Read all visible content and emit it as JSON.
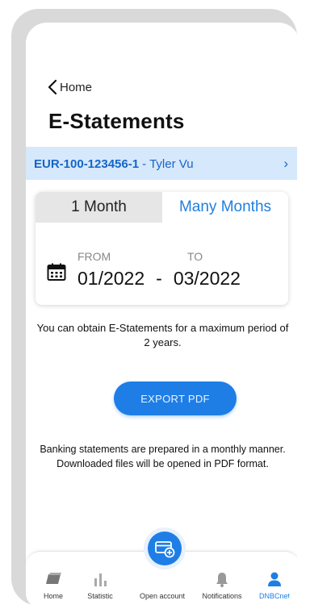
{
  "header": {
    "back_label": "Home",
    "title": "E-Statements"
  },
  "account": {
    "id": "EUR-100-123456-1",
    "separator": "-",
    "name": "Tyler Vu",
    "arrow": "›"
  },
  "period": {
    "tabs": [
      {
        "label": "1 Month",
        "active": true
      },
      {
        "label": "Many Months",
        "active": false
      }
    ],
    "from_label": "FROM",
    "to_label": "TO",
    "from_value": "01/2022",
    "range_separator": "-",
    "to_value": "03/2022",
    "icon": "calendar-icon"
  },
  "info_text": "You can obtain E-Statements for a maximum period of 2 years.",
  "export_button": "EXPORT PDF",
  "note_text": "Banking statements are prepared in a monthly manner. Downloaded files will be opened in PDF format.",
  "tabbar": {
    "items": [
      {
        "label": "Home",
        "icon": "home-icon"
      },
      {
        "label": "Statistic",
        "icon": "bar-chart-icon"
      },
      {
        "label": "Open account",
        "icon": "card-add-icon"
      },
      {
        "label": "Notifications",
        "icon": "bell-icon"
      },
      {
        "label": "DNBCnet",
        "icon": "user-icon",
        "active": true
      }
    ]
  },
  "colors": {
    "accent": "#1e7ee6",
    "account_bar": "#d6e8fb",
    "frame": "#d9d9d9"
  }
}
